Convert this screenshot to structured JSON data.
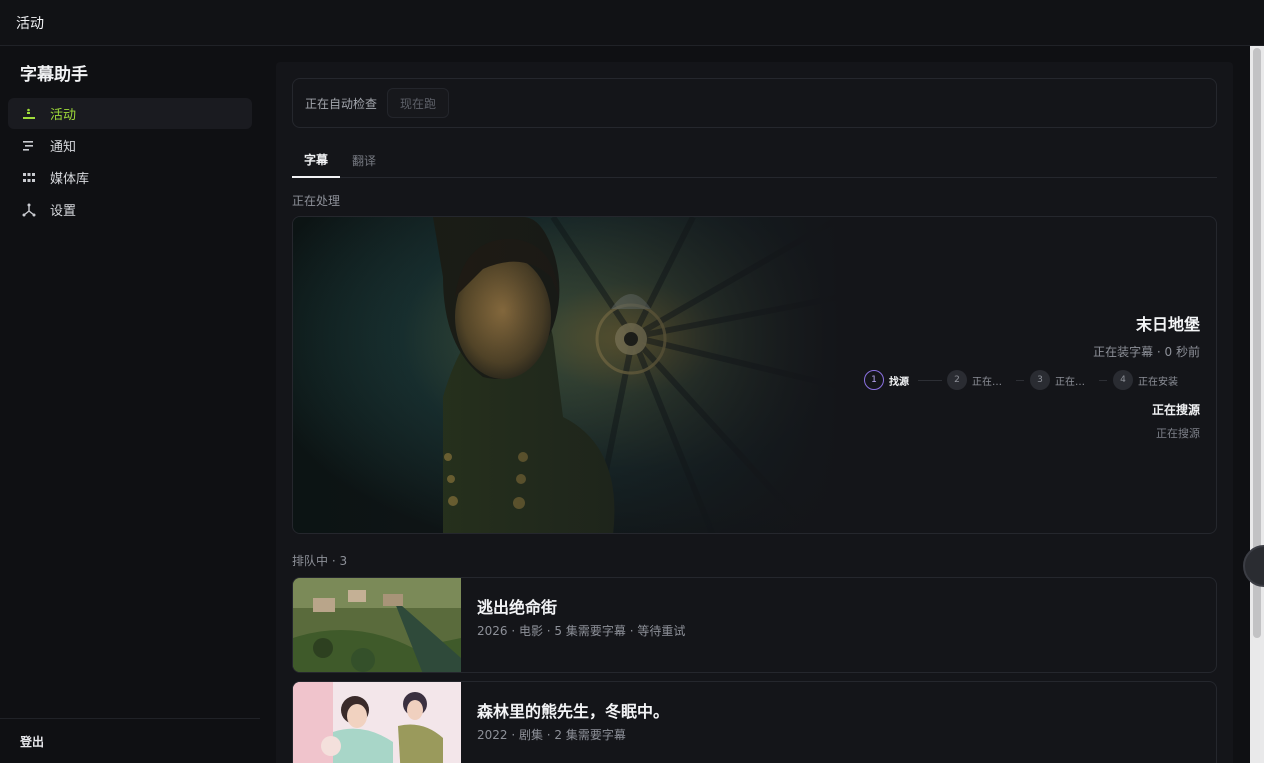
{
  "topbar": {
    "title": "活动"
  },
  "sidebar": {
    "brand": "字幕助手",
    "items": [
      {
        "label": "活动",
        "icon": "activity-icon",
        "active": true
      },
      {
        "label": "通知",
        "icon": "bell-list-icon",
        "active": false
      },
      {
        "label": "媒体库",
        "icon": "grid-library-icon",
        "active": false
      },
      {
        "label": "设置",
        "icon": "settings-nodes-icon",
        "active": false
      }
    ],
    "logout": "登出"
  },
  "main": {
    "auto_check_label": "正在自动检查",
    "run_now_label": "现在跑",
    "tabs": [
      {
        "label": "字幕",
        "active": true
      },
      {
        "label": "翻译",
        "active": false
      }
    ],
    "processing_label": "正在处理",
    "processing": {
      "title": "末日地堡",
      "subtitle": "正在装字幕 · 0 秒前",
      "steps": [
        {
          "num": "1",
          "label": "找源",
          "active": true
        },
        {
          "num": "2",
          "label": "正在…",
          "active": false
        },
        {
          "num": "3",
          "label": "正在…",
          "active": false
        },
        {
          "num": "4",
          "label": "正在安装",
          "active": false
        }
      ],
      "status": "正在搜源",
      "status_detail": "正在搜源"
    },
    "queue_label": "排队中 · 3",
    "queue": [
      {
        "title": "逃出绝命街",
        "meta": "2026 · 电影 · 5 集需要字幕 · 等待重试"
      },
      {
        "title": "森林里的熊先生，冬眠中。",
        "meta": "2022 · 剧集 · 2 集需要字幕"
      }
    ]
  },
  "colors": {
    "accent_green": "#9fdc3a",
    "step_purple": "#8a70e0",
    "background": "#0f1013"
  }
}
